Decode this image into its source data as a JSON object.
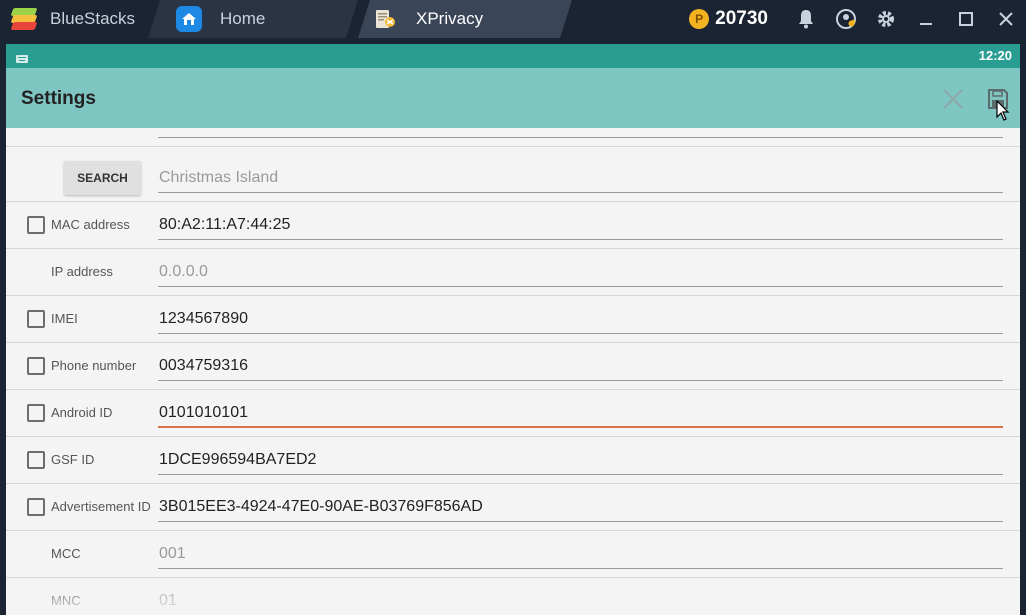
{
  "window": {
    "brand": "BlueStacks",
    "tabs": [
      {
        "label": "Home"
      },
      {
        "label": "XPrivacy"
      }
    ],
    "coins": "20730",
    "coin_glyph": "P"
  },
  "status_bar": {
    "time": "12:20"
  },
  "action_bar": {
    "title": "Settings"
  },
  "form": {
    "top_field_value": "",
    "search": {
      "button_label": "SEARCH",
      "value": "Christmas Island"
    },
    "rows": [
      {
        "label": "MAC address",
        "value": "80:A2:11:A7:44:25",
        "checkbox": true,
        "hint": false,
        "focused": false
      },
      {
        "label": "IP address",
        "value": "0.0.0.0",
        "checkbox": false,
        "hint": true,
        "focused": false
      },
      {
        "label": "IMEI",
        "value": "1234567890",
        "checkbox": true,
        "hint": false,
        "focused": false
      },
      {
        "label": "Phone number",
        "value": "0034759316",
        "checkbox": true,
        "hint": false,
        "focused": false
      },
      {
        "label": "Android ID",
        "value": "0101010101",
        "checkbox": true,
        "hint": false,
        "focused": true
      },
      {
        "label": "GSF ID",
        "value": "1DCE996594BA7ED2",
        "checkbox": true,
        "hint": false,
        "focused": false
      },
      {
        "label": "Advertisement ID",
        "value": "3B015EE3-4924-47E0-90AE-B03769F856AD",
        "checkbox": true,
        "hint": false,
        "focused": false
      },
      {
        "label": "MCC",
        "value": "001",
        "checkbox": false,
        "hint": true,
        "focused": false
      },
      {
        "label": "MNC",
        "value": "01",
        "checkbox": false,
        "hint": true,
        "focused": false
      }
    ]
  },
  "colors": {
    "status_bar": "#2a9d93",
    "action_bar": "#7fc5c2",
    "focus_underline": "#d9734a"
  }
}
